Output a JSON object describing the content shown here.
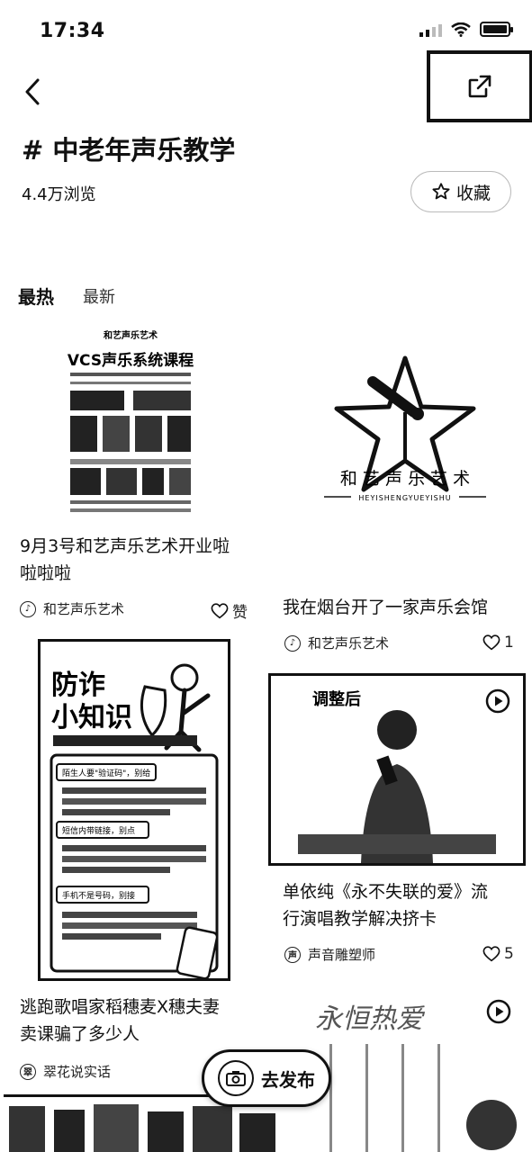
{
  "status": {
    "time": "17:34"
  },
  "topic": {
    "title": "# 中老年声乐教学",
    "views": "4.4万浏览",
    "favorite_label": "收藏"
  },
  "tabs": [
    {
      "label": "最热"
    },
    {
      "label": "最新"
    }
  ],
  "posts": [
    {
      "image": {
        "brand": "和艺声乐艺术",
        "headline": "VCS声乐系统课程"
      },
      "title_line1": "9月3号和艺声乐艺术开业啦",
      "title_line2": "啦啦啦",
      "author": "和艺声乐艺术",
      "likes": "赞"
    },
    {
      "image": {
        "brand": "和 艺 声 乐 艺 术",
        "sub": "HEYISHENGYUEYISHU"
      },
      "title_line1": "我在烟台开了一家声乐会馆",
      "author": "和艺声乐艺术",
      "likes": "1"
    },
    {
      "image": {
        "headline1": "防诈",
        "headline2": "小知识",
        "s1": "陌生人要\"验证码\"，别给",
        "s2": "短信内带链接，别点",
        "s3": "手机不是号码，别接"
      },
      "title_line1": "逃跑歌唱家稻穗麦X穗夫妻",
      "title_line2": "卖课骗了多少人",
      "author": "翠花说实话"
    },
    {
      "image": {
        "tag": "调整后"
      },
      "title_line1": "单依纯《永不失联的爱》流",
      "title_line2": "行演唱教学解决挤卡",
      "author": "声音雕塑师",
      "likes": "5"
    },
    {
      "image": {
        "text": "永恒热爱"
      }
    }
  ],
  "post_button": {
    "label": "去发布"
  },
  "icons": {
    "back": "chevron-left-icon",
    "share": "share-icon",
    "star": "star-outline-icon",
    "heart": "heart-outline-icon",
    "play": "play-circle-icon"
  }
}
